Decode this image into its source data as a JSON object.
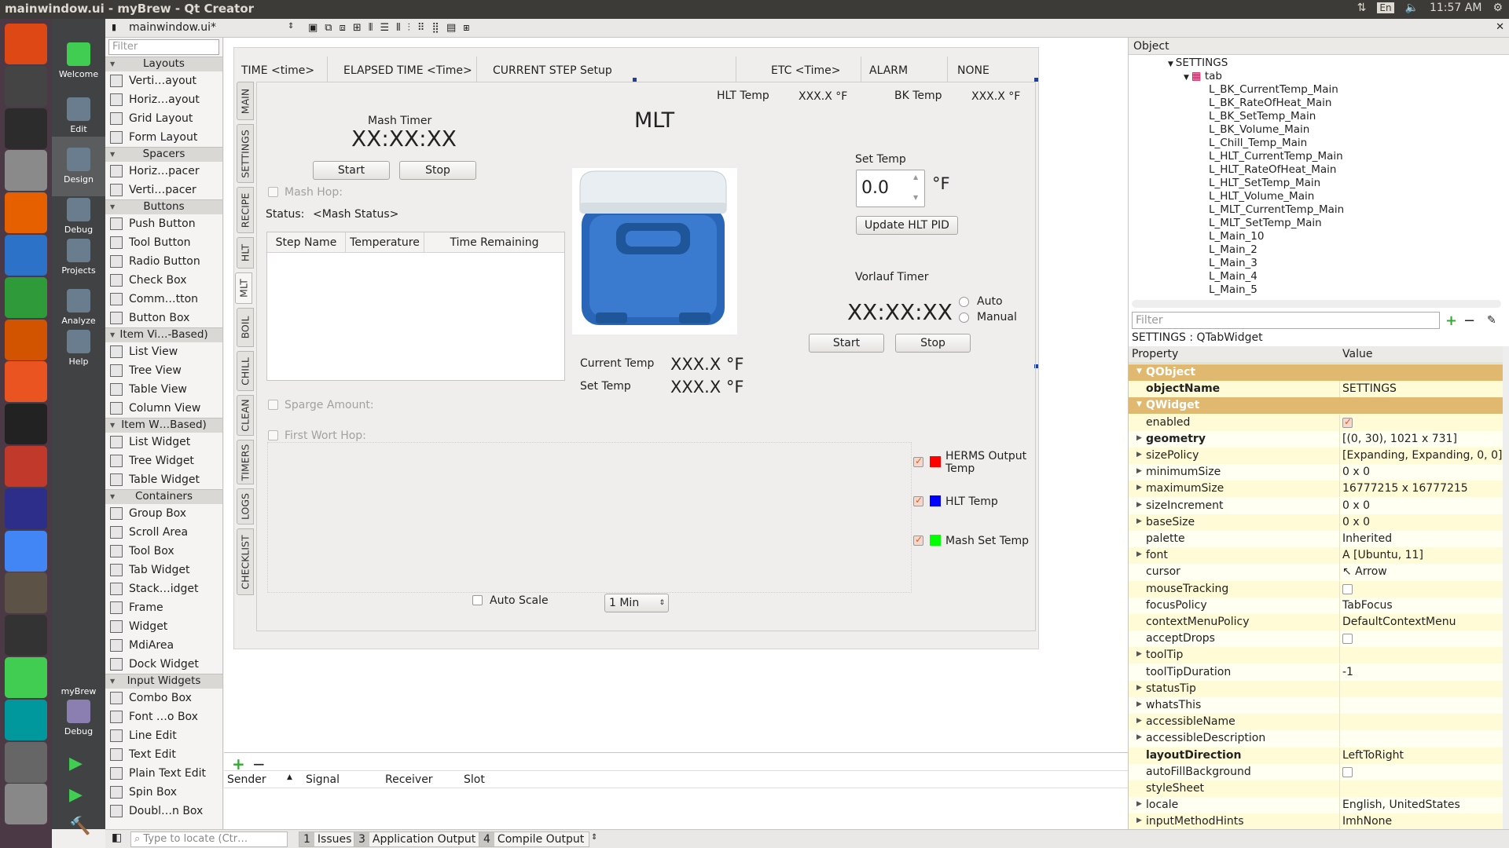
{
  "window": {
    "title": "mainwindow.ui - myBrew - Qt Creator",
    "clock": "11:57 AM",
    "keyboard": "En"
  },
  "launcher": {
    "icons": [
      "ubuntu-dash-icon",
      "calculator-icon",
      "terminal-icon",
      "files-icon",
      "firefox-icon",
      "writer-icon",
      "calc-icon",
      "impress-icon",
      "software-center-icon",
      "amazon-icon",
      "settings-icon",
      "eclipse-icon",
      "chrome-icon",
      "gimp-icon",
      "inkscape-icon",
      "qt-creator-icon",
      "arduino-icon",
      "screenshot-icon",
      "disks-icon"
    ]
  },
  "modes": [
    {
      "label": "Welcome",
      "icon": "qt-logo-icon"
    },
    {
      "label": "Edit",
      "icon": "edit-icon"
    },
    {
      "label": "Design",
      "icon": "design-icon"
    },
    {
      "label": "Debug",
      "icon": "debug-icon"
    },
    {
      "label": "Projects",
      "icon": "projects-icon"
    },
    {
      "label": "Analyze",
      "icon": "analyze-icon"
    },
    {
      "label": "Help",
      "icon": "help-icon"
    }
  ],
  "kit": {
    "project": "myBrew",
    "config": "Debug"
  },
  "editor": {
    "file": "mainwindow.ui*"
  },
  "widgetbox": {
    "filter_placeholder": "Filter",
    "sections": [
      {
        "title": "Layouts",
        "items": [
          "Verti…ayout",
          "Horiz…ayout",
          "Grid Layout",
          "Form Layout"
        ]
      },
      {
        "title": "Spacers",
        "items": [
          "Horiz…pacer",
          "Verti…pacer"
        ]
      },
      {
        "title": "Buttons",
        "items": [
          "Push Button",
          "Tool Button",
          "Radio Button",
          "Check Box",
          "Comm…tton",
          "Button Box"
        ]
      },
      {
        "title": "Item Vi…-Based)",
        "items": [
          "List View",
          "Tree View",
          "Table View",
          "Column View"
        ]
      },
      {
        "title": "Item W…Based)",
        "items": [
          "List Widget",
          "Tree Widget",
          "Table Widget"
        ]
      },
      {
        "title": "Containers",
        "items": [
          "Group Box",
          "Scroll Area",
          "Tool Box",
          "Tab Widget",
          "Stack…idget",
          "Frame",
          "Widget",
          "MdiArea",
          "Dock Widget"
        ]
      },
      {
        "title": "Input Widgets",
        "items": [
          "Combo Box",
          "Font …o Box",
          "Line Edit",
          "Text Edit",
          "Plain Text Edit",
          "Spin Box",
          "Doubl…n Box"
        ]
      }
    ]
  },
  "form": {
    "header": {
      "time": "TIME <time>",
      "elapsed": "ELAPSED TIME  <Time>",
      "step": "CURRENT STEP  Setup",
      "etc": "ETC <Time>",
      "alarm": "ALARM",
      "alarm_value": "NONE"
    },
    "tabs": [
      "MAIN",
      "SETTINGS",
      "RECIPE",
      "HLT",
      "MLT",
      "BOIL",
      "CHILL",
      "CLEAN",
      "TIMERS",
      "LOGS",
      "CHECKLIST"
    ],
    "hlt_temp_label": "HLT Temp",
    "hlt_temp_value": "XXX.X  °F",
    "bk_temp_label": "BK Temp",
    "bk_temp_value": "XXX.X  °F",
    "mash_timer_label": "Mash Timer",
    "mash_timer_value": "XX:XX:XX",
    "start": "Start",
    "stop": "Stop",
    "mlt_title": "MLT",
    "mash_hop": "Mash Hop:",
    "status_label": "Status:",
    "status_value": "<Mash Status>",
    "table_headers": [
      "Step Name",
      "Temperature",
      "Time Remaining"
    ],
    "sparge": "Sparge Amount:",
    "first_wort": "First Wort Hop:",
    "current_temp_label": "Current Temp",
    "current_temp_value": "XXX.X °F",
    "set_temp_label": "Set Temp",
    "set_temp_value": "XXX.X °F",
    "set_temp_title": "Set Temp",
    "set_temp_input": "0.0",
    "set_temp_unit": "°F",
    "update_pid": "Update HLT PID",
    "vorlauf_label": "Vorlauf Timer",
    "vorlauf_value": "XX:XX:XX",
    "auto": "Auto",
    "manual": "Manual",
    "legend": [
      {
        "label": "HERMS Output Temp",
        "color": "#ff0000"
      },
      {
        "label": "HLT Temp",
        "color": "#0000ff"
      },
      {
        "label": "Mash Set Temp",
        "color": "#00ff00"
      }
    ],
    "auto_scale": "Auto Scale",
    "interval": "1 Min"
  },
  "object_inspector": {
    "header": "Object",
    "root": "SETTINGS",
    "child": "tab",
    "items": [
      "L_BK_CurrentTemp_Main",
      "L_BK_RateOfHeat_Main",
      "L_BK_SetTemp_Main",
      "L_BK_Volume_Main",
      "L_Chill_Temp_Main",
      "L_HLT_CurrentTemp_Main",
      "L_HLT_RateOfHeat_Main",
      "L_HLT_SetTemp_Main",
      "L_HLT_Volume_Main",
      "L_MLT_CurrentTemp_Main",
      "L_MLT_SetTemp_Main",
      "L_Main_10",
      "L_Main_2",
      "L_Main_3",
      "L_Main_4",
      "L_Main_5"
    ]
  },
  "property_editor": {
    "filter_placeholder": "Filter",
    "context": "SETTINGS : QTabWidget",
    "col_property": "Property",
    "col_value": "Value",
    "rows": [
      {
        "name": "QObject",
        "value": "",
        "kind": "group"
      },
      {
        "name": "objectName",
        "value": "SETTINGS",
        "kind": "bold"
      },
      {
        "name": "QWidget",
        "value": "",
        "kind": "group"
      },
      {
        "name": "enabled",
        "value": "",
        "kind": "check-on"
      },
      {
        "name": "geometry",
        "value": "[(0, 30), 1021 x 731]",
        "kind": "bold-exp"
      },
      {
        "name": "sizePolicy",
        "value": "[Expanding, Expanding, 0, 0]",
        "kind": "exp"
      },
      {
        "name": "minimumSize",
        "value": "0 x 0",
        "kind": "exp"
      },
      {
        "name": "maximumSize",
        "value": "16777215 x 16777215",
        "kind": "exp"
      },
      {
        "name": "sizeIncrement",
        "value": "0 x 0",
        "kind": "exp"
      },
      {
        "name": "baseSize",
        "value": "0 x 0",
        "kind": "exp"
      },
      {
        "name": "palette",
        "value": "Inherited",
        "kind": ""
      },
      {
        "name": "font",
        "value": "A  [Ubuntu, 11]",
        "kind": "exp"
      },
      {
        "name": "cursor",
        "value": "↖  Arrow",
        "kind": ""
      },
      {
        "name": "mouseTracking",
        "value": "",
        "kind": "check-off"
      },
      {
        "name": "focusPolicy",
        "value": "TabFocus",
        "kind": ""
      },
      {
        "name": "contextMenuPolicy",
        "value": "DefaultContextMenu",
        "kind": ""
      },
      {
        "name": "acceptDrops",
        "value": "",
        "kind": "check-off"
      },
      {
        "name": "toolTip",
        "value": "",
        "kind": "exp"
      },
      {
        "name": "toolTipDuration",
        "value": "-1",
        "kind": ""
      },
      {
        "name": "statusTip",
        "value": "",
        "kind": "exp"
      },
      {
        "name": "whatsThis",
        "value": "",
        "kind": "exp"
      },
      {
        "name": "accessibleName",
        "value": "",
        "kind": "exp"
      },
      {
        "name": "accessibleDescription",
        "value": "",
        "kind": "exp"
      },
      {
        "name": "layoutDirection",
        "value": "LeftToRight",
        "kind": "bold"
      },
      {
        "name": "autoFillBackground",
        "value": "",
        "kind": "check-off"
      },
      {
        "name": "styleSheet",
        "value": "",
        "kind": ""
      },
      {
        "name": "locale",
        "value": "English, UnitedStates",
        "kind": "exp"
      },
      {
        "name": "inputMethodHints",
        "value": "ImhNone",
        "kind": "exp"
      }
    ]
  },
  "signals": {
    "headers": [
      "Sender",
      "Signal",
      "Receiver",
      "Slot"
    ]
  },
  "statusbar": {
    "locate_placeholder": "Type to locate (Ctr…",
    "tabs": [
      {
        "n": "1",
        "label": "Issues"
      },
      {
        "n": "3",
        "label": "Application Output"
      },
      {
        "n": "4",
        "label": "Compile Output"
      }
    ]
  }
}
